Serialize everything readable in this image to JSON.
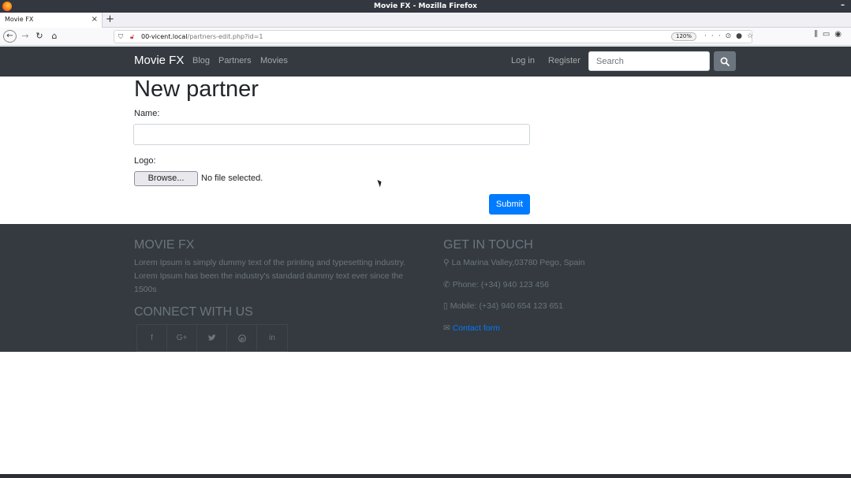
{
  "browser": {
    "window_title": "Movie FX - Mozilla Firefox",
    "tab_title": "Movie FX",
    "url_host": "00-vicent.local",
    "url_path": "/partners-edit.php?id=1",
    "zoom": "120%"
  },
  "site": {
    "brand": "Movie FX",
    "nav_links": [
      "Blog",
      "Partners",
      "Movies"
    ],
    "login": "Log in",
    "register": "Register",
    "search_placeholder": "Search"
  },
  "form": {
    "title": "New partner",
    "name_label": "Name:",
    "name_value": "",
    "logo_label": "Logo:",
    "browse_label": "Browse...",
    "file_status": "No file selected.",
    "submit_label": "Submit"
  },
  "footer": {
    "brand_heading": "MOVIE FX",
    "lorem": "Lorem Ipsum is simply dummy text of the printing and typesetting industry. Lorem Ipsum has been the industry's standard dummy text ever since the 1500s",
    "connect_heading": "CONNECT WITH US",
    "social": [
      {
        "icon": "facebook-icon",
        "glyph": "f"
      },
      {
        "icon": "google-plus-icon",
        "glyph": "G+"
      },
      {
        "icon": "twitter-icon",
        "glyph": "✓"
      },
      {
        "icon": "pinterest-icon",
        "glyph": "℗"
      },
      {
        "icon": "linkedin-icon",
        "glyph": "in"
      }
    ],
    "touch_heading": "GET IN TOUCH",
    "address": "La Marina Valley,03780 Pego, Spain",
    "phone": "Phone: (+34) 940 123 456",
    "mobile": "Mobile: (+34) 940 654 123 651",
    "contact_link": "Contact form"
  },
  "colors": {
    "navbar_bg": "#343a40",
    "primary": "#007bff",
    "muted": "#6c757d"
  }
}
